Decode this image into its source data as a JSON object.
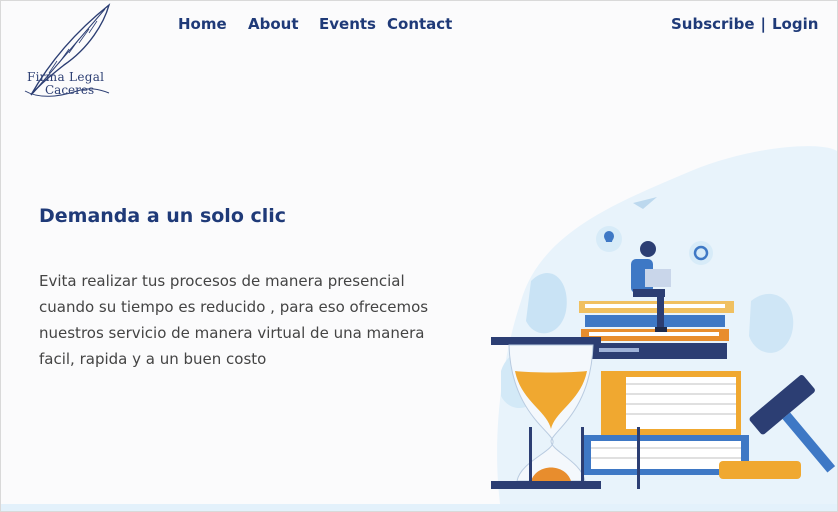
{
  "brand": {
    "line1": "Firma Legal",
    "line2": "Caceres"
  },
  "nav": {
    "items": [
      {
        "label": "Home"
      },
      {
        "label": "About"
      },
      {
        "label": "Events"
      },
      {
        "label": "Contact"
      }
    ],
    "subscribe": "Subscribe",
    "separator": "|",
    "login": "Login"
  },
  "hero": {
    "headline": "Demanda a un solo clic",
    "body_lines": [
      "Evita realizar tus procesos de manera presencial",
      "cuando su tiempo es reducido , para eso ofrecemos",
      " nuestros servicio de manera virtual de una manera",
      " facil, rapida y a un buen costo"
    ]
  },
  "colors": {
    "nav_text": "#1f3a78",
    "headline": "#1f3a78",
    "body_text": "#444444",
    "accent_orange": "#f0a830",
    "accent_blue": "#3e78c5",
    "light_blue": "#e3f1fb"
  }
}
